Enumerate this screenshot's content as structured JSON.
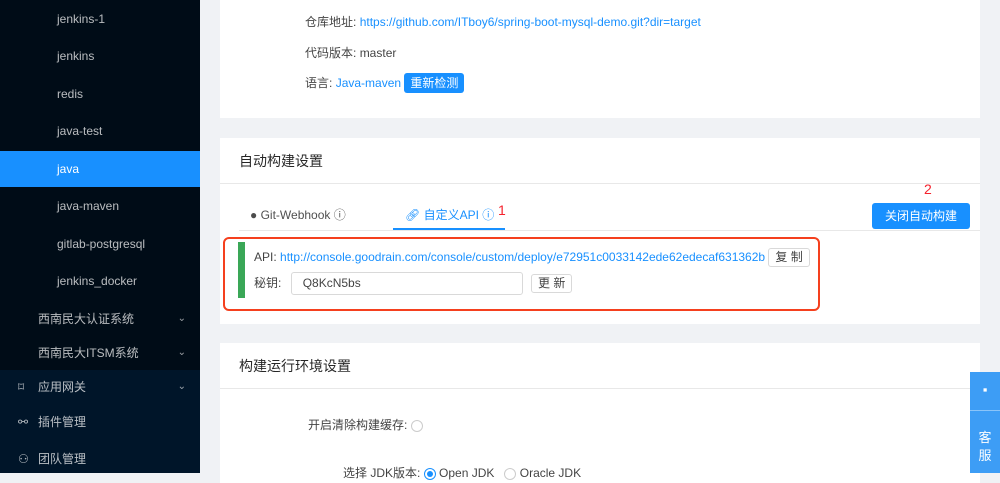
{
  "sidebar": {
    "sub_items": [
      "jenkins-1",
      "jenkins",
      "redis",
      "java-test",
      "java",
      "java-maven",
      "gitlab-postgresql",
      "jenkins_docker"
    ],
    "groups": [
      "西南民大认证系统",
      "西南民大ITSM系统"
    ],
    "top_items": [
      "应用网关",
      "插件管理",
      "团队管理"
    ]
  },
  "repo": {
    "repo_label": "仓库地址:",
    "repo_url": "https://github.com/ITboy6/spring-boot-mysql-demo.git?dir=target",
    "version_label": "代码版本:",
    "version": "master",
    "lang_label": "语言:",
    "lang": "Java-maven",
    "recheck": "重新检测"
  },
  "auto": {
    "title": "自动构建设置",
    "tab_webhook": "Git-Webhook",
    "tab_api": "自定义API",
    "annot1": "1",
    "annot2": "2",
    "close_btn": "关闭自动构建",
    "api_label": "API:",
    "api_url": "http://console.goodrain.com/console/custom/deploy/e72951c0033142ede62edecaf631362b",
    "copy": "复 制",
    "secret_label": "秘钥:",
    "secret": "Q8KcN5bs",
    "update": "更 新"
  },
  "env": {
    "title": "构建运行环境设置",
    "cache_label": "开启清除构建缓存:",
    "jdk_label": "选择 JDK版本:",
    "jdk_options": [
      "Open JDK",
      "Oracle JDK"
    ]
  },
  "support": {
    "label": "客服"
  }
}
